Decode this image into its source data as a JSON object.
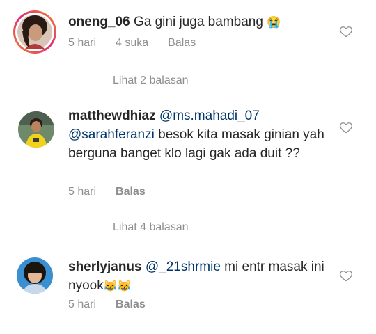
{
  "comments": [
    {
      "username": "oneng_06",
      "text": "Ga gini juga bambang",
      "emoji": "😭",
      "time": "5 hari",
      "likes": "4 suka",
      "reply": "Balas",
      "view_replies": "Lihat 2 balasan"
    },
    {
      "username": "matthewdhiaz",
      "mention1": "@ms.mahadi_07",
      "mention2": "@sarahferanzi",
      "text": " besok kita masak ginian yah berguna banget klo lagi gak ada duit ??",
      "time": "5 hari",
      "reply": "Balas",
      "view_replies": "Lihat 4 balasan"
    },
    {
      "username": "sherlyjanus",
      "mention1": "@_21shrmie",
      "text": " mi entr masak ini nyook",
      "emoji": "😹😹",
      "time": "5 hari",
      "reply": "Balas"
    }
  ],
  "icons": [
    "heart-icon"
  ],
  "colors": {
    "text": "#262626",
    "mention": "#003569",
    "meta": "#8e8e8e",
    "story_ring_start": "#f58529",
    "story_ring_end": "#dd2a7b"
  }
}
